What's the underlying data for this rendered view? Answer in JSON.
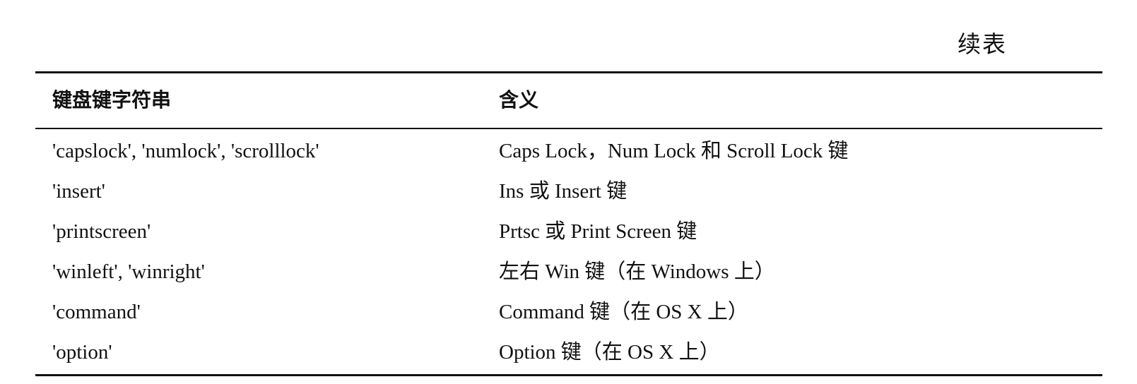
{
  "continued_label": "续表",
  "table": {
    "headers": [
      "键盘键字符串",
      "含义"
    ],
    "rows": [
      [
        "'capslock', 'numlock', 'scrolllock'",
        "Caps Lock，Num Lock 和 Scroll Lock 键"
      ],
      [
        "'insert'",
        "Ins 或 Insert 键"
      ],
      [
        "'printscreen'",
        "Prtsc 或 Print Screen 键"
      ],
      [
        "'winleft', 'winright'",
        "左右 Win 键（在 Windows 上）"
      ],
      [
        "'command'",
        "Command 键（在 OS X 上）"
      ],
      [
        "'option'",
        "Option 键（在 OS X 上）"
      ]
    ]
  }
}
